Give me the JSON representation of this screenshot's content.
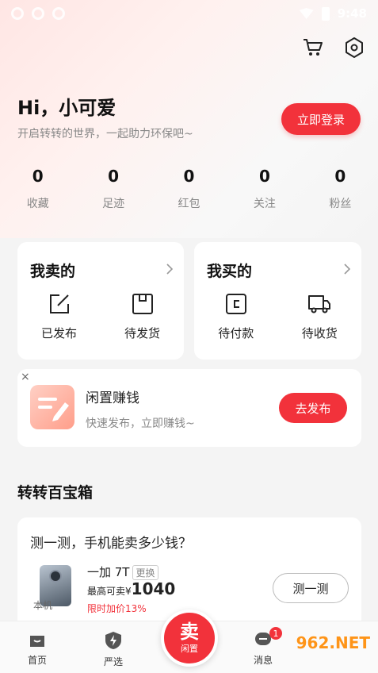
{
  "status_bar": {
    "time": "9:48"
  },
  "profile": {
    "greeting": "Hi，小可爱",
    "subtitle": "开启转转的世界，一起助力环保吧~",
    "login_label": "立即登录"
  },
  "stats": [
    {
      "value": "0",
      "label": "收藏"
    },
    {
      "value": "0",
      "label": "足迹"
    },
    {
      "value": "0",
      "label": "红包"
    },
    {
      "value": "0",
      "label": "关注"
    },
    {
      "value": "0",
      "label": "粉丝"
    }
  ],
  "sell_card": {
    "title": "我卖的",
    "items": [
      {
        "label": "已发布",
        "icon": "edit-icon"
      },
      {
        "label": "待发货",
        "icon": "package-icon"
      }
    ]
  },
  "buy_card": {
    "title": "我买的",
    "items": [
      {
        "label": "待付款",
        "icon": "wallet-icon"
      },
      {
        "label": "待收货",
        "icon": "truck-icon"
      }
    ]
  },
  "promo": {
    "close": "×",
    "title": "闲置赚钱",
    "subtitle": "快速发布，立即赚钱~",
    "button": "去发布"
  },
  "section_title": "转转百宝箱",
  "quote": {
    "title": "测一测，手机能卖多少钱？",
    "phone_tag": "本机",
    "model": "一加 7T",
    "change": "更换",
    "price_prefix": "最高可卖",
    "currency": "¥",
    "price": "1040",
    "discount": "限时加价13%",
    "button": "测一测"
  },
  "tabbar": {
    "home": "首页",
    "selected": "严选",
    "sell_main": "卖",
    "sell_sub": "闲置",
    "messages": "消息",
    "message_badge": "1"
  },
  "watermark": "962.NET",
  "colors": {
    "accent": "#f2323b"
  }
}
